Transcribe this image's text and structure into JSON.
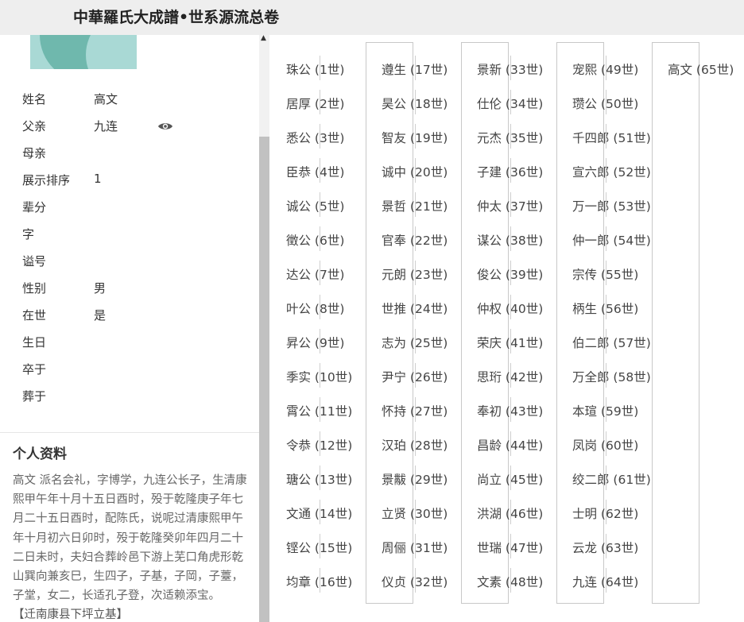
{
  "header": {
    "title": "中華羅氏大成譜•世系源流总卷"
  },
  "profile": {
    "fields": [
      {
        "label": "姓名",
        "value": "高文"
      },
      {
        "label": "父亲",
        "value": "九连"
      },
      {
        "label": "母亲",
        "value": ""
      },
      {
        "label": "展示排序",
        "value": "1"
      },
      {
        "label": "辈分",
        "value": ""
      },
      {
        "label": "字",
        "value": ""
      },
      {
        "label": "谥号",
        "value": ""
      },
      {
        "label": "性别",
        "value": "男"
      },
      {
        "label": "在世",
        "value": "是"
      },
      {
        "label": "生日",
        "value": ""
      },
      {
        "label": "卒于",
        "value": ""
      },
      {
        "label": "葬于",
        "value": ""
      }
    ],
    "eye_icon": "eye-icon"
  },
  "bio": {
    "title": "个人资料",
    "text": "高文 派名会礼，字博学，九连公长子，生清康熙甲午年十月十五日酉时，殁于乾隆庚子年七月二十五日酉时，配陈氏，说呢过清康熙甲午年十月初六日卯时，殁于乾隆癸卯年四月二十二日未时，夫妇合葬岭邑下游上芜口角虎形乾山巽向兼亥巳，生四子，子基，子岡，子薹，子堂，女二，长适孔子登，次适赖添宝。",
    "note": "【迁南康县下坪立基】"
  },
  "lineage": {
    "columns": [
      [
        "珠公 (1世)",
        "居厚 (2世)",
        "悉公 (3世)",
        "臣恭 (4世)",
        "诚公 (5世)",
        "徵公 (6世)",
        "达公 (7世)",
        "叶公 (8世)",
        "昇公 (9世)",
        "季实 (10世)",
        "霄公 (11世)",
        "令恭 (12世)",
        "瑭公 (13世)",
        "文通 (14世)",
        "铿公 (15世)",
        "均章 (16世)"
      ],
      [
        "遵生 (17世)",
        "昊公 (18世)",
        "智友 (19世)",
        "诚中 (20世)",
        "景哲 (21世)",
        "官奉 (22世)",
        "元朗 (23世)",
        "世推 (24世)",
        "志为 (25世)",
        "尹宁 (26世)",
        "怀持 (27世)",
        "汉珀 (28世)",
        "景黻 (29世)",
        "立贤 (30世)",
        "周俪 (31世)",
        "仪贞 (32世)"
      ],
      [
        "景新 (33世)",
        "仕伦 (34世)",
        "元杰 (35世)",
        "子建 (36世)",
        "仲太 (37世)",
        "谋公 (38世)",
        "俊公 (39世)",
        "仲权 (40世)",
        "荣庆 (41世)",
        "思珩 (42世)",
        "奉初 (43世)",
        "昌龄 (44世)",
        "尚立 (45世)",
        "洪湖 (46世)",
        "世瑞 (47世)",
        "文素 (48世)"
      ],
      [
        "宠熙 (49世)",
        "瓒公 (50世)",
        "千四郎 (51世)",
        "宣六郎 (52世)",
        "万一郎 (53世)",
        "仲一郎 (54世)",
        "宗传 (55世)",
        "柄生 (56世)",
        "伯二郎 (57世)",
        "万全郎 (58世)",
        "本瑄 (59世)",
        "凤岗 (60世)",
        "绞二郎 (61世)",
        "士明 (62世)",
        "云龙 (63世)",
        "九连 (64世)"
      ],
      [
        "高文 (65世)"
      ]
    ]
  }
}
